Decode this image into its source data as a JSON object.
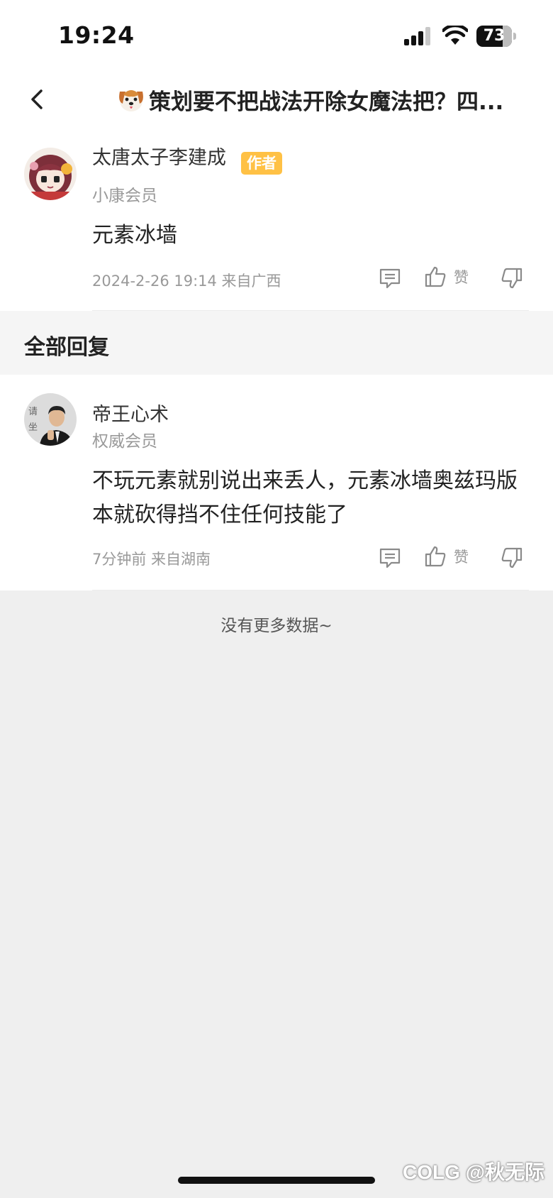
{
  "status_bar": {
    "time": "19:24",
    "battery_level": "73",
    "battery_fraction": 0.73,
    "icons": [
      "signal-icon",
      "wifi-icon",
      "battery-icon"
    ]
  },
  "nav": {
    "back_icon": "chevron-left-icon",
    "title_emoji_icon": "dog-face-icon",
    "title": "策划要不把战法开除女魔法把？四..."
  },
  "main_post": {
    "author": "太唐太子李建成",
    "badge": "作者",
    "member_level": "小康会员",
    "content": "元素冰墙",
    "meta": "2024-2-26 19:14  来自广西",
    "like_label": "赞",
    "badge_color": "#ffc145"
  },
  "section": {
    "title": "全部回复"
  },
  "replies": [
    {
      "author": "帝王心术",
      "member_level": "权威会员",
      "content": "不玩元素就别说出来丢人，元素冰墙奥兹玛版本就砍得挡不住任何技能了",
      "meta": "7分钟前 来自湖南",
      "like_label": "赞"
    }
  ],
  "footer": {
    "no_more": "没有更多数据~"
  },
  "watermark": "COLG @秋无际"
}
